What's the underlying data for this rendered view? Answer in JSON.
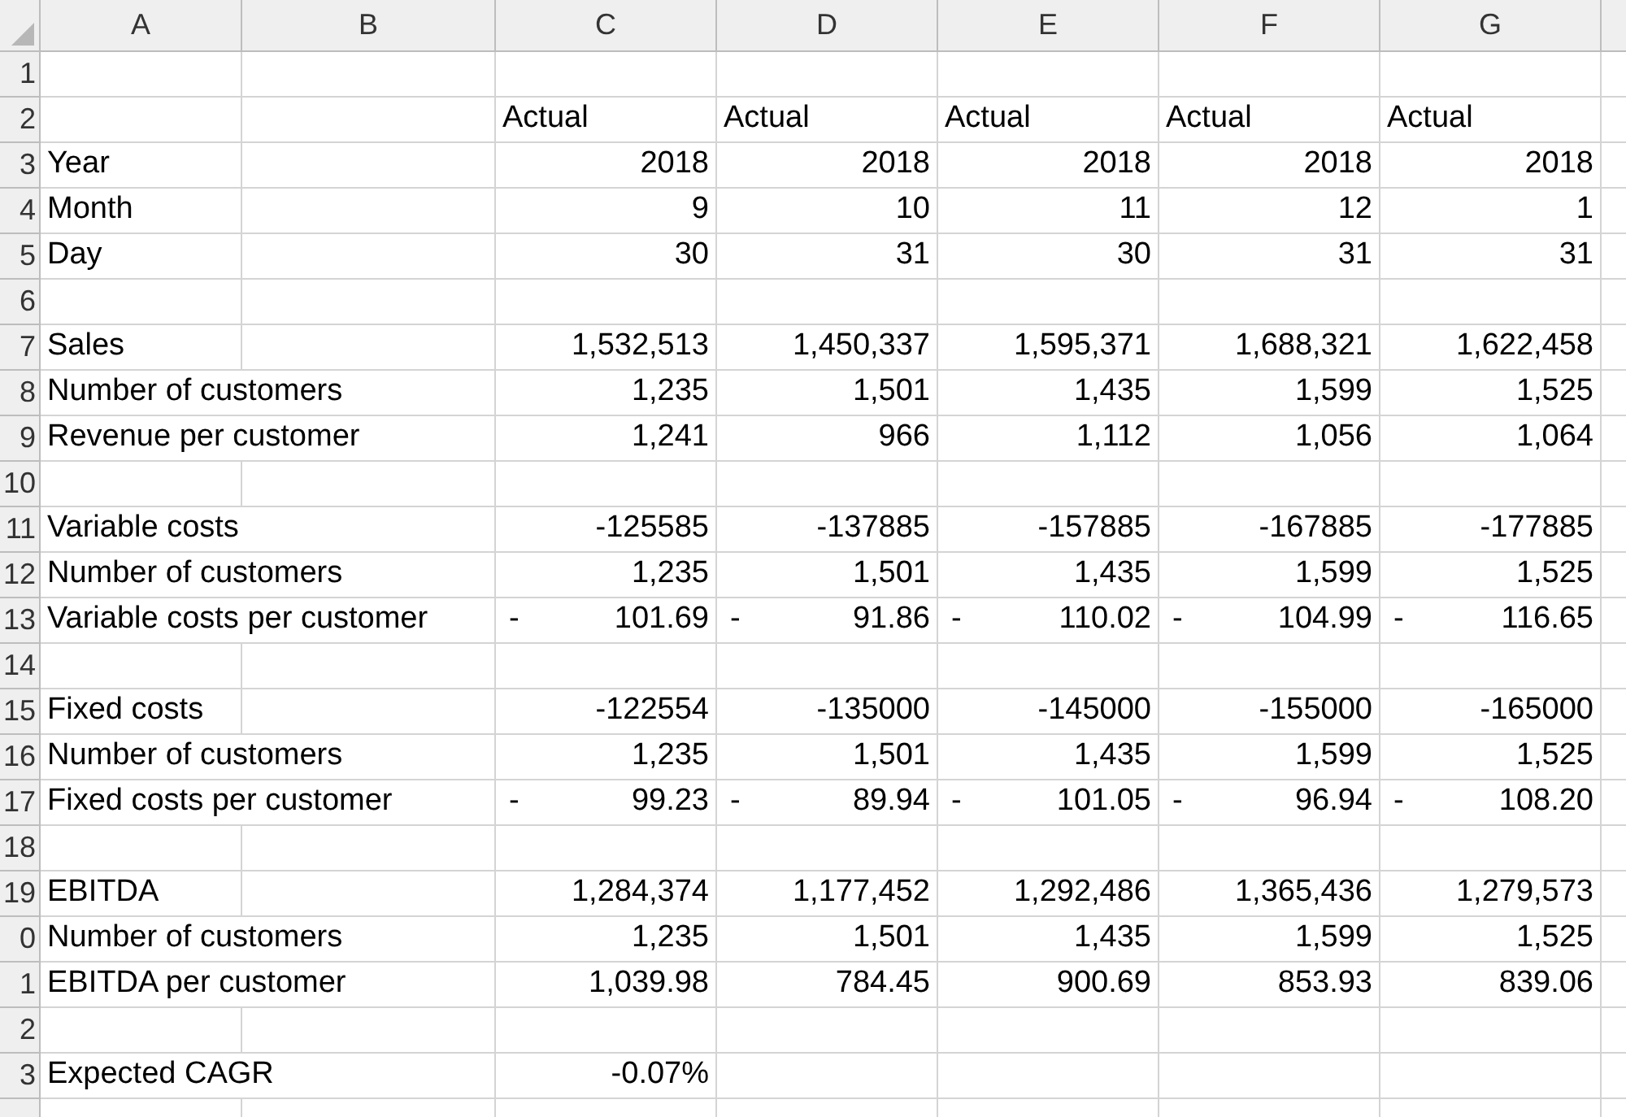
{
  "columns": [
    "A",
    "B",
    "C",
    "D",
    "E",
    "F",
    "G"
  ],
  "rows": [
    {
      "number": "1",
      "kind": "blank"
    },
    {
      "number": "2",
      "kind": "heading",
      "values": [
        {
          "text": "Actual"
        },
        {
          "text": "Actual"
        },
        {
          "text": "Actual"
        },
        {
          "text": "Actual"
        },
        {
          "text": "Actual"
        }
      ]
    },
    {
      "number": "3",
      "kind": "data",
      "label": "Year",
      "values": [
        {
          "text": "2018"
        },
        {
          "text": "2018"
        },
        {
          "text": "2018"
        },
        {
          "text": "2018"
        },
        {
          "text": "2018"
        }
      ]
    },
    {
      "number": "4",
      "kind": "data",
      "label": "Month",
      "values": [
        {
          "text": "9"
        },
        {
          "text": "10"
        },
        {
          "text": "11"
        },
        {
          "text": "12"
        },
        {
          "text": "1"
        }
      ]
    },
    {
      "number": "5",
      "kind": "data",
      "label": "Day",
      "values": [
        {
          "text": "30"
        },
        {
          "text": "31"
        },
        {
          "text": "30"
        },
        {
          "text": "31"
        },
        {
          "text": "31"
        }
      ]
    },
    {
      "number": "6",
      "kind": "blank"
    },
    {
      "number": "7",
      "kind": "data",
      "label": "Sales",
      "values": [
        {
          "text": "1,532,513"
        },
        {
          "text": "1,450,337"
        },
        {
          "text": "1,595,371"
        },
        {
          "text": "1,688,321"
        },
        {
          "text": "1,622,458"
        }
      ]
    },
    {
      "number": "8",
      "kind": "data",
      "label": "Number of customers",
      "values": [
        {
          "text": "1,235"
        },
        {
          "text": "1,501"
        },
        {
          "text": "1,435"
        },
        {
          "text": "1,599"
        },
        {
          "text": "1,525"
        }
      ]
    },
    {
      "number": "9",
      "kind": "data",
      "label": "Revenue per customer",
      "values": [
        {
          "text": "1,241"
        },
        {
          "text": "966"
        },
        {
          "text": "1,112"
        },
        {
          "text": "1,056"
        },
        {
          "text": "1,064"
        }
      ]
    },
    {
      "number": "10",
      "kind": "blank"
    },
    {
      "number": "11",
      "kind": "data",
      "label": "Variable costs",
      "values": [
        {
          "text": "-125585"
        },
        {
          "text": "-137885"
        },
        {
          "text": "-157885"
        },
        {
          "text": "-167885"
        },
        {
          "text": "-177885"
        }
      ]
    },
    {
      "number": "12",
      "kind": "data",
      "label": "Number of customers",
      "values": [
        {
          "text": "1,235"
        },
        {
          "text": "1,501"
        },
        {
          "text": "1,435"
        },
        {
          "text": "1,599"
        },
        {
          "text": "1,525"
        }
      ]
    },
    {
      "number": "13",
      "kind": "data",
      "label": "Variable costs per customer",
      "values": [
        {
          "sign": "-",
          "text": "101.69"
        },
        {
          "sign": "-",
          "text": "91.86"
        },
        {
          "sign": "-",
          "text": "110.02"
        },
        {
          "sign": "-",
          "text": "104.99"
        },
        {
          "sign": "-",
          "text": "116.65"
        }
      ]
    },
    {
      "number": "14",
      "kind": "blank"
    },
    {
      "number": "15",
      "kind": "data",
      "label": "Fixed costs",
      "values": [
        {
          "text": "-122554"
        },
        {
          "text": "-135000"
        },
        {
          "text": "-145000"
        },
        {
          "text": "-155000"
        },
        {
          "text": "-165000"
        }
      ]
    },
    {
      "number": "16",
      "kind": "data",
      "label": "Number of customers",
      "values": [
        {
          "text": "1,235"
        },
        {
          "text": "1,501"
        },
        {
          "text": "1,435"
        },
        {
          "text": "1,599"
        },
        {
          "text": "1,525"
        }
      ]
    },
    {
      "number": "17",
      "kind": "data",
      "label": "Fixed costs per customer",
      "values": [
        {
          "sign": "-",
          "text": "99.23"
        },
        {
          "sign": "-",
          "text": "89.94"
        },
        {
          "sign": "-",
          "text": "101.05"
        },
        {
          "sign": "-",
          "text": "96.94"
        },
        {
          "sign": "-",
          "text": "108.20"
        }
      ]
    },
    {
      "number": "18",
      "kind": "blank"
    },
    {
      "number": "19",
      "kind": "data",
      "label": "EBITDA",
      "values": [
        {
          "text": "1,284,374"
        },
        {
          "text": "1,177,452"
        },
        {
          "text": "1,292,486"
        },
        {
          "text": "1,365,436"
        },
        {
          "text": "1,279,573"
        }
      ]
    },
    {
      "number": "0",
      "kind": "data",
      "label": "Number of customers",
      "values": [
        {
          "text": "1,235"
        },
        {
          "text": "1,501"
        },
        {
          "text": "1,435"
        },
        {
          "text": "1,599"
        },
        {
          "text": "1,525"
        }
      ]
    },
    {
      "number": "1",
      "kind": "data",
      "label": "EBITDA per customer",
      "values": [
        {
          "text": "1,039.98"
        },
        {
          "text": "784.45"
        },
        {
          "text": "900.69"
        },
        {
          "text": "853.93"
        },
        {
          "text": "839.06"
        }
      ]
    },
    {
      "number": "2",
      "kind": "blank"
    },
    {
      "number": "3",
      "kind": "data",
      "label": "Expected CAGR",
      "values": [
        {
          "text": "-0.07%"
        }
      ]
    }
  ]
}
